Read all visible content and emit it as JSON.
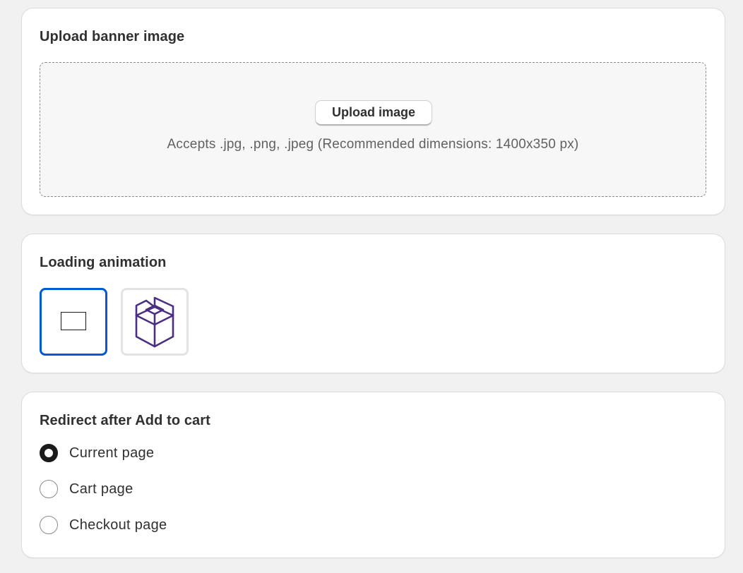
{
  "upload": {
    "title": "Upload banner image",
    "button_label": "Upload image",
    "hint": "Accepts .jpg, .png, .jpeg (Recommended dimensions: 1400x350 px)"
  },
  "loading": {
    "title": "Loading animation",
    "options": [
      {
        "icon": "blank-rectangle-icon",
        "selected": true
      },
      {
        "icon": "box-package-icon",
        "selected": false
      }
    ],
    "selected_color": "#005bd3",
    "box_icon_color": "#4a2f80"
  },
  "redirect": {
    "title": "Redirect after Add to cart",
    "options": [
      {
        "label": "Current page",
        "selected": true
      },
      {
        "label": "Cart page",
        "selected": false
      },
      {
        "label": "Checkout page",
        "selected": false
      }
    ]
  }
}
